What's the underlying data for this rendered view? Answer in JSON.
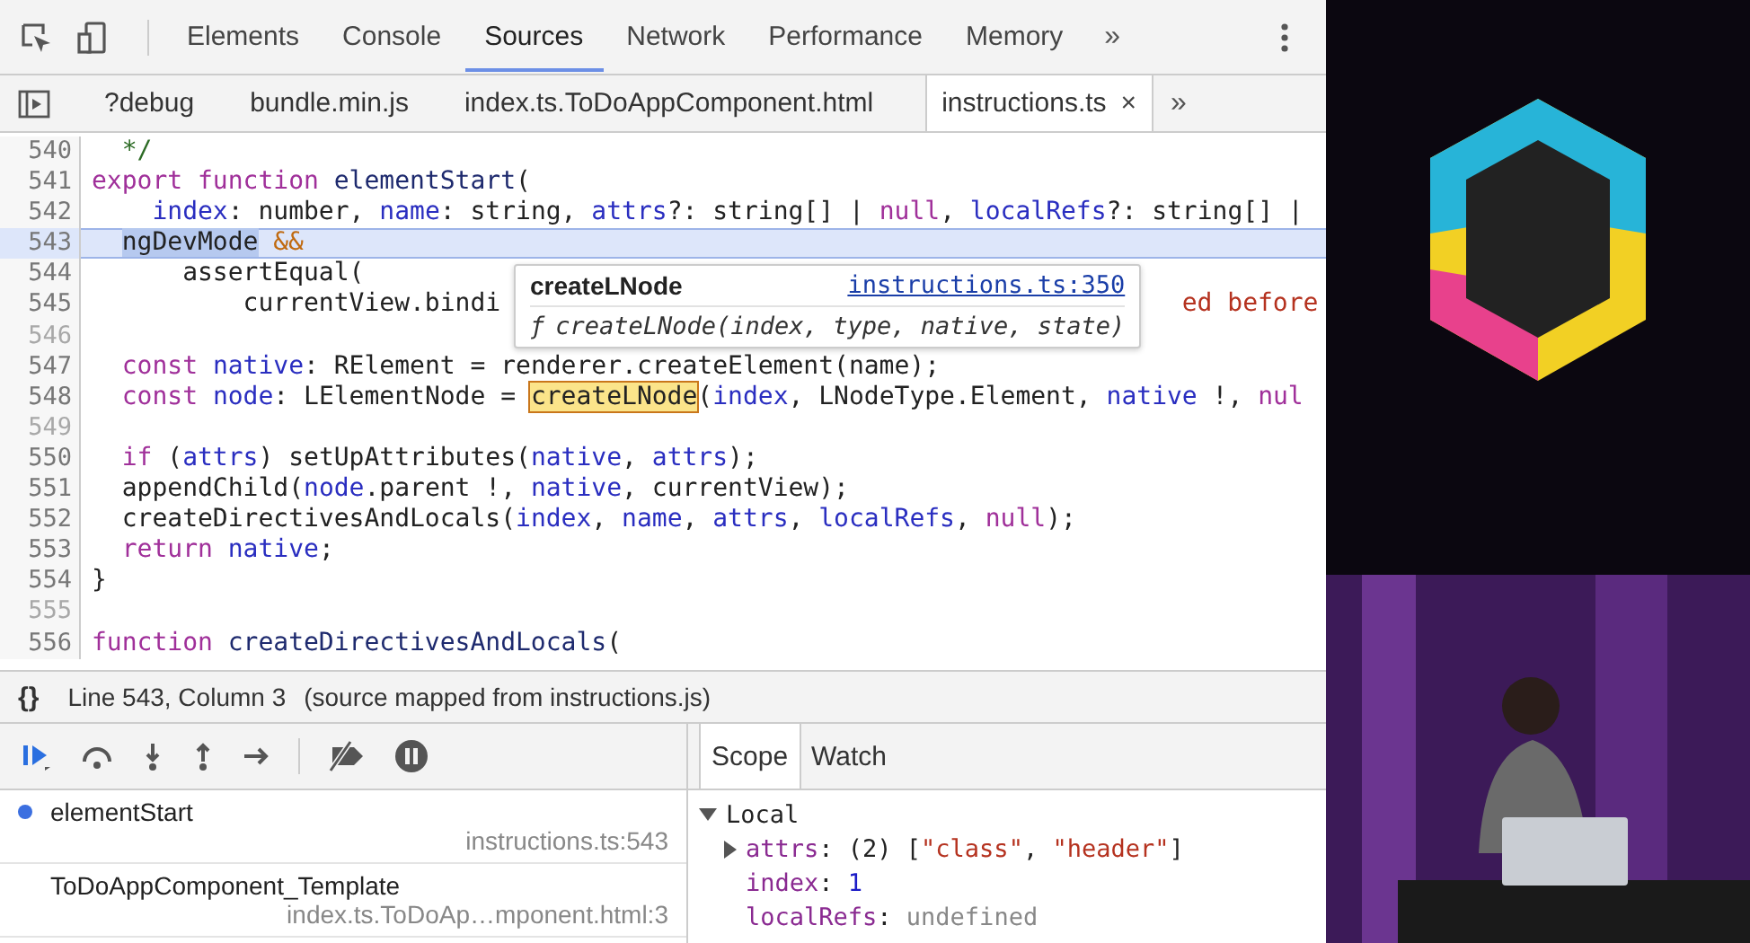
{
  "main_tabs": [
    {
      "label": "Elements",
      "selected": false
    },
    {
      "label": "Console",
      "selected": false
    },
    {
      "label": "Sources",
      "selected": true
    },
    {
      "label": "Network",
      "selected": false
    },
    {
      "label": "Performance",
      "selected": false
    },
    {
      "label": "Memory",
      "selected": false
    }
  ],
  "main_more": "»",
  "file_tabs": [
    {
      "label": "?debug",
      "selected": false
    },
    {
      "label": "bundle.min.js",
      "selected": false
    },
    {
      "label": "index.ts.ToDoAppComponent.html",
      "selected": false
    },
    {
      "label": "instructions.ts",
      "selected": true,
      "close": "×"
    }
  ],
  "file_more": "»",
  "code": {
    "lines": [
      {
        "number": "540",
        "dimmed": false,
        "current": false,
        "tokens": [
          {
            "kind": "cm",
            "text": "  */"
          }
        ]
      },
      {
        "number": "541",
        "dimmed": false,
        "current": false,
        "tokens": [
          {
            "kind": "kw",
            "text": "export function "
          },
          {
            "kind": "fn",
            "text": "elementStart"
          },
          {
            "kind": "p",
            "text": "("
          }
        ]
      },
      {
        "number": "542",
        "dimmed": false,
        "current": false,
        "tokens": [
          {
            "kind": "id",
            "text": "    index"
          },
          {
            "kind": "p",
            "text": ": number, "
          },
          {
            "kind": "id",
            "text": "name"
          },
          {
            "kind": "p",
            "text": ": string, "
          },
          {
            "kind": "id",
            "text": "attrs"
          },
          {
            "kind": "p",
            "text": "?: string[] | "
          },
          {
            "kind": "kw",
            "text": "null"
          },
          {
            "kind": "p",
            "text": ", "
          },
          {
            "kind": "id",
            "text": "localRefs"
          },
          {
            "kind": "p",
            "text": "?: string[] |"
          }
        ]
      },
      {
        "number": "543",
        "dimmed": false,
        "current": true,
        "tokens": [
          {
            "kind": "indent"
          },
          {
            "kind": "sel",
            "text": "ngDevMode"
          },
          {
            "kind": "op",
            "text": " &&"
          }
        ]
      },
      {
        "number": "544",
        "dimmed": false,
        "current": false,
        "tokens": [
          {
            "kind": "p",
            "text": "      assertEqual("
          }
        ]
      },
      {
        "number": "545",
        "dimmed": false,
        "current": false,
        "tokens": [
          {
            "kind": "p",
            "text": "          currentView.bindi"
          },
          {
            "kind": "gap"
          },
          {
            "kind": "str",
            "text": "ed before"
          }
        ]
      },
      {
        "number": "546",
        "dimmed": true,
        "current": false
      },
      {
        "number": "547",
        "dimmed": false,
        "current": false,
        "tokens": [
          {
            "kind": "kw",
            "text": "  const "
          },
          {
            "kind": "id",
            "text": "native"
          },
          {
            "kind": "p",
            "text": ": RElement = renderer.createElement(name);"
          }
        ]
      },
      {
        "number": "548",
        "dimmed": false,
        "current": false,
        "tokens": [
          {
            "kind": "kw",
            "text": "  const "
          },
          {
            "kind": "id",
            "text": "node"
          },
          {
            "kind": "p",
            "text": ": LElementNode = "
          },
          {
            "kind": "mark",
            "text": "createLNode"
          },
          {
            "kind": "p",
            "text": "("
          },
          {
            "kind": "id",
            "text": "index"
          },
          {
            "kind": "p",
            "text": ", LNodeType.Element, "
          },
          {
            "kind": "id",
            "text": "native"
          },
          {
            "kind": "p",
            "text": " !, "
          },
          {
            "kind": "kw",
            "text": "nul"
          }
        ]
      },
      {
        "number": "549",
        "dimmed": true,
        "current": false
      },
      {
        "number": "550",
        "dimmed": false,
        "current": false,
        "tokens": [
          {
            "kind": "kw",
            "text": "  if"
          },
          {
            "kind": "p",
            "text": " ("
          },
          {
            "kind": "id",
            "text": "attrs"
          },
          {
            "kind": "p",
            "text": ") setUpAttributes("
          },
          {
            "kind": "id",
            "text": "native"
          },
          {
            "kind": "p",
            "text": ", "
          },
          {
            "kind": "id",
            "text": "attrs"
          },
          {
            "kind": "p",
            "text": ");"
          }
        ]
      },
      {
        "number": "551",
        "dimmed": false,
        "current": false,
        "tokens": [
          {
            "kind": "p",
            "text": "  appendChild("
          },
          {
            "kind": "id",
            "text": "node"
          },
          {
            "kind": "p",
            "text": ".parent !, "
          },
          {
            "kind": "id",
            "text": "native"
          },
          {
            "kind": "p",
            "text": ", currentView);"
          }
        ]
      },
      {
        "number": "552",
        "dimmed": false,
        "current": false,
        "tokens": [
          {
            "kind": "p",
            "text": "  createDirectivesAndLocals("
          },
          {
            "kind": "id",
            "text": "index"
          },
          {
            "kind": "p",
            "text": ", "
          },
          {
            "kind": "id",
            "text": "name"
          },
          {
            "kind": "p",
            "text": ", "
          },
          {
            "kind": "id",
            "text": "attrs"
          },
          {
            "kind": "p",
            "text": ", "
          },
          {
            "kind": "id",
            "text": "localRefs"
          },
          {
            "kind": "p",
            "text": ", "
          },
          {
            "kind": "kw",
            "text": "null"
          },
          {
            "kind": "p",
            "text": ");"
          }
        ]
      },
      {
        "number": "553",
        "dimmed": false,
        "current": false,
        "tokens": [
          {
            "kind": "kw",
            "text": "  return "
          },
          {
            "kind": "id",
            "text": "native"
          },
          {
            "kind": "p",
            "text": ";"
          }
        ]
      },
      {
        "number": "554",
        "dimmed": false,
        "current": false,
        "tokens": [
          {
            "kind": "p",
            "text": "}"
          }
        ]
      },
      {
        "number": "555",
        "dimmed": true,
        "current": false
      },
      {
        "number": "556",
        "dimmed": false,
        "current": false,
        "tokens": [
          {
            "kind": "kw",
            "text": "function "
          },
          {
            "kind": "fn",
            "text": "createDirectivesAndLocals"
          },
          {
            "kind": "p",
            "text": "("
          }
        ]
      }
    ]
  },
  "tooltip": {
    "name": "createLNode",
    "link": "instructions.ts:350",
    "signature_mark": "ƒ",
    "signature": "createLNode(index, type, native, state)"
  },
  "status_bar": {
    "format_button": "{}",
    "position": "Line 543, Column 3",
    "note": "(source mapped from instructions.js)"
  },
  "call_stack": [
    {
      "name": "elementStart",
      "location": "instructions.ts:543",
      "current": true
    },
    {
      "name": "ToDoAppComponent_Template",
      "location": "index.ts.ToDoAp…mponent.html:3",
      "current": false
    }
  ],
  "scope_tabs": [
    {
      "label": "Scope",
      "selected": true
    },
    {
      "label": "Watch",
      "selected": false
    }
  ],
  "scope": [
    {
      "label": "Local",
      "expanded": true,
      "children": [
        {
          "expandable": true,
          "expanded": false,
          "tokens": [
            {
              "kind": "key",
              "text": "attrs"
            },
            {
              "kind": "p",
              "text": ": (2) ["
            },
            {
              "kind": "str",
              "text": "\"class\""
            },
            {
              "kind": "p",
              "text": ", "
            },
            {
              "kind": "str",
              "text": "\"header\""
            },
            {
              "kind": "p",
              "text": "]"
            }
          ]
        },
        {
          "expandable": false,
          "tokens": [
            {
              "kind": "key",
              "text": "index"
            },
            {
              "kind": "p",
              "text": ": "
            },
            {
              "kind": "num",
              "text": "1"
            }
          ]
        },
        {
          "expandable": false,
          "tokens": [
            {
              "kind": "key",
              "text": "localRefs"
            },
            {
              "kind": "p",
              "text": ": "
            },
            {
              "kind": "undef",
              "text": "undefined"
            }
          ]
        }
      ]
    }
  ]
}
